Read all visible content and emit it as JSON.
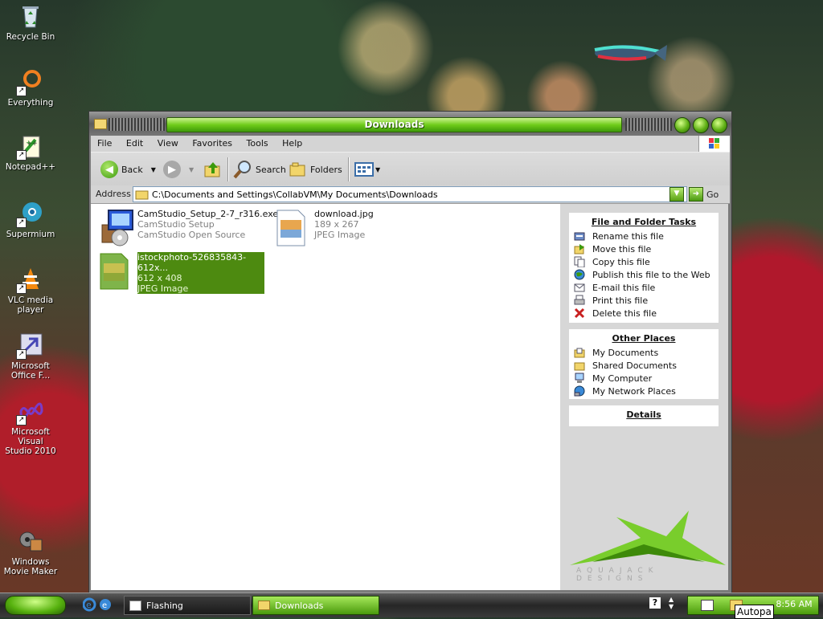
{
  "desktop": {
    "icons": [
      {
        "label": "Recycle Bin"
      },
      {
        "label": "Everything"
      },
      {
        "label": "Notepad++"
      },
      {
        "label": "Supermium"
      },
      {
        "label": "VLC media player"
      },
      {
        "label": "Microsoft Office F..."
      },
      {
        "label": "Microsoft Visual Studio 2010"
      },
      {
        "label": "Windows Movie Maker"
      }
    ]
  },
  "window": {
    "title": "Downloads",
    "menu": [
      "File",
      "Edit",
      "View",
      "Favorites",
      "Tools",
      "Help"
    ],
    "toolbar": {
      "back": "Back",
      "search": "Search",
      "folders": "Folders"
    },
    "address": {
      "label": "Address",
      "path": "C:\\Documents and Settings\\CollabVM\\My Documents\\Downloads",
      "go": "Go"
    },
    "files": [
      {
        "name": "CamStudio_Setup_2-7_r316.exe",
        "line2": "CamStudio Setup",
        "line3": "CamStudio Open Source"
      },
      {
        "name": "download.jpg",
        "line2": "189 x 267",
        "line3": "JPEG Image"
      },
      {
        "name": "istockphoto-526835843-612x...",
        "line2": "612 x 408",
        "line3": "JPEG Image"
      }
    ],
    "tasks": {
      "file_folder_title": "File and Folder Tasks",
      "file_folder": [
        "Rename this file",
        "Move this file",
        "Copy this file",
        "Publish this file to the Web",
        "E-mail this file",
        "Print this file",
        "Delete this file"
      ],
      "other_title": "Other Places",
      "other": [
        "My Documents",
        "Shared Documents",
        "My Computer",
        "My Network Places"
      ],
      "details_title": "Details"
    },
    "brand": "AQUAJACK DESIGNS"
  },
  "taskbar": {
    "tasks": [
      "Flashing",
      "Downloads"
    ],
    "clock": "8:56 AM",
    "tooltip": "Autopa"
  },
  "colors": {
    "accent_green": "#6fcc1a",
    "selection": "#4d8a10"
  }
}
